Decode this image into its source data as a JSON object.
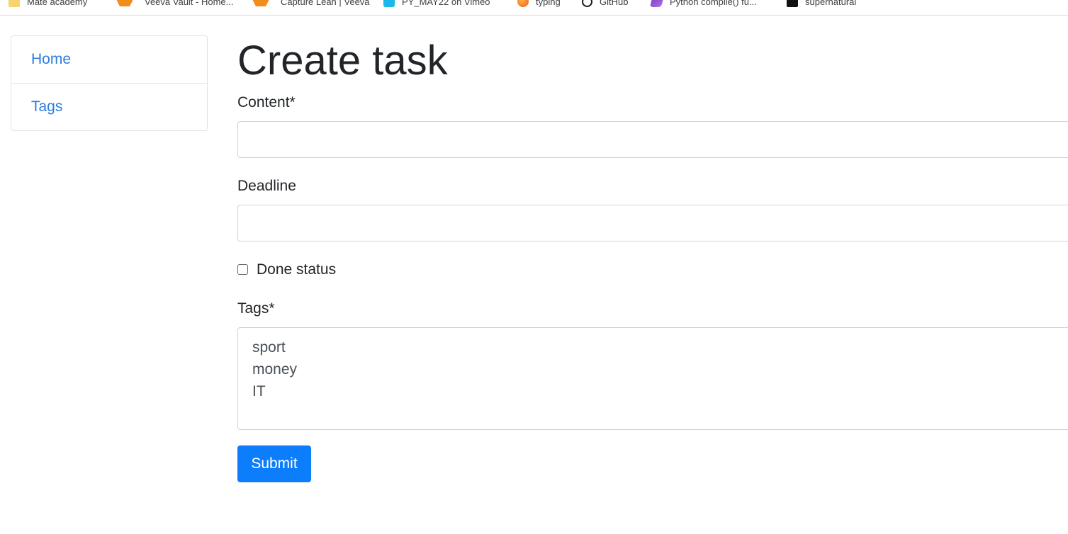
{
  "bookmarks": [
    {
      "label": "Mate academy",
      "icon": "folder-icon"
    },
    {
      "label": "Veeva Vault - Home...",
      "icon": "veeva-icon"
    },
    {
      "label": "Capture Lean | Veeva",
      "icon": "veeva-icon"
    },
    {
      "label": "PY_MAY22 on Vimeo",
      "icon": "vimeo-icon"
    },
    {
      "label": "typing",
      "icon": "typing-icon"
    },
    {
      "label": "GitHub",
      "icon": "github-icon"
    },
    {
      "label": "Python compile() fu...",
      "icon": "python-icon"
    },
    {
      "label": "supernatural",
      "icon": "video-icon"
    }
  ],
  "sidebar": {
    "items": [
      {
        "label": "Home"
      },
      {
        "label": "Tags"
      }
    ]
  },
  "main": {
    "title": "Create task",
    "content_label": "Content*",
    "content_value": "",
    "deadline_label": "Deadline",
    "deadline_value": "",
    "done_label": "Done status",
    "done_checked": false,
    "tags_label": "Tags*",
    "tag_options": [
      "sport",
      "money",
      "IT"
    ],
    "submit_label": "Submit"
  },
  "colors": {
    "link": "#2a7de1",
    "primary_button": "#0d7efb",
    "text": "#212529",
    "border": "#ced4da"
  }
}
